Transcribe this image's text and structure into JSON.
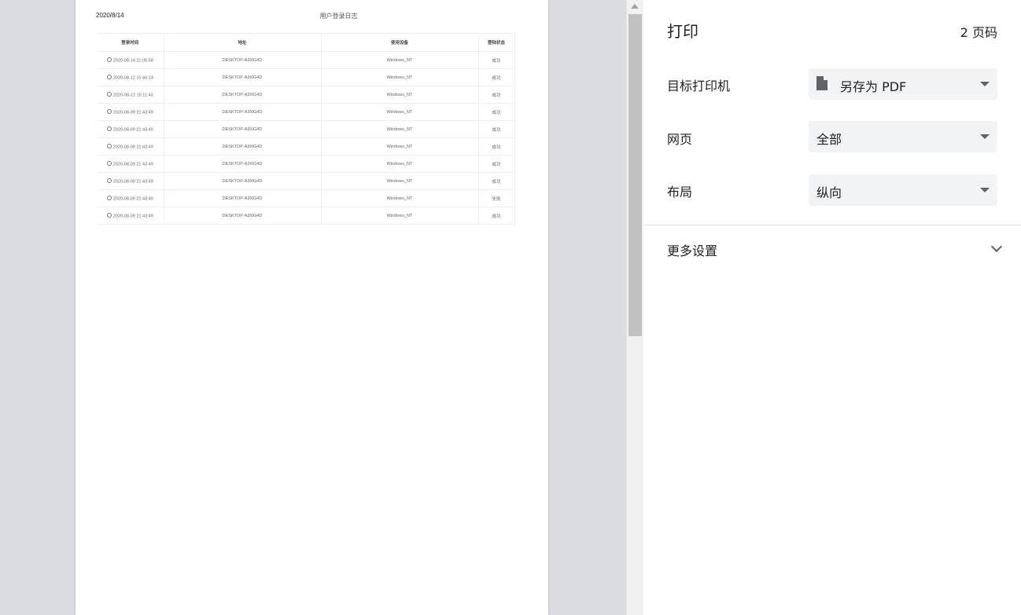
{
  "preview": {
    "date": "2020/8/14",
    "title": "用户登录日志",
    "columns": [
      "登录时间",
      "地址",
      "使用设备",
      "登陆状态"
    ],
    "rows": [
      [
        "2020-08-14 21:05:58",
        "DESKTOP-A3I0G4D",
        "Windows_NT",
        "成功"
      ],
      [
        "2020-08-12 15:46:14",
        "DESKTOP-A3I0G4D",
        "Windows_NT",
        "成功"
      ],
      [
        "2020-08-12 15:11:43",
        "DESKTOP-A3I0G4D",
        "Windows_NT",
        "成功"
      ],
      [
        "2020-08-09 21:43:49",
        "DESKTOP-A3I0G4D",
        "Windows_NT",
        "成功"
      ],
      [
        "2020-08-09 21:43:49",
        "DESKTOP-A3I0G4D",
        "Windows_NT",
        "成功"
      ],
      [
        "2020-08-09 21:43:49",
        "DESKTOP-A3I0G4D",
        "Windows_NT",
        "成功"
      ],
      [
        "2020-08-09 21:43:49",
        "DESKTOP-A3I0G4D",
        "Windows_NT",
        "成功"
      ],
      [
        "2020-08-09 21:43:49",
        "DESKTOP-A3I0G4D",
        "Windows_NT",
        "成功"
      ],
      [
        "2020-08-09 21:43:49",
        "DESKTOP-A3I0G4D",
        "Windows_NT",
        "失败"
      ],
      [
        "2020-08-09 21:43:49",
        "DESKTOP-A3I0G4D",
        "Windows_NT",
        "成功"
      ]
    ]
  },
  "panel": {
    "title": "打印",
    "page_count": "2 页码",
    "destination": {
      "label": "目标打印机",
      "value": "另存为 PDF",
      "icon": "pdf-file-icon"
    },
    "pages": {
      "label": "网页",
      "value": "全部"
    },
    "layout": {
      "label": "布局",
      "value": "纵向"
    },
    "more_settings": "更多设置"
  }
}
